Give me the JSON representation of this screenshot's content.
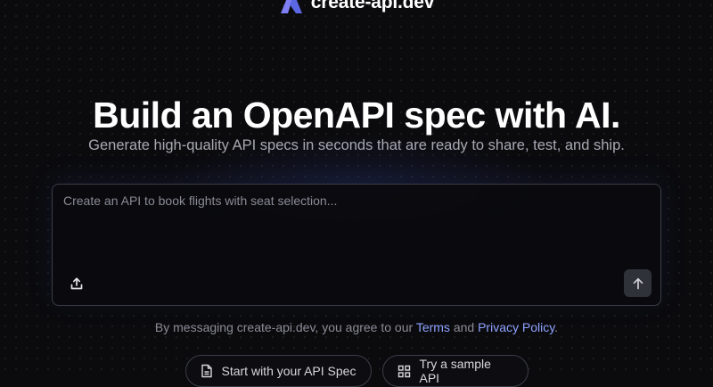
{
  "brand": {
    "name": "create-api.dev",
    "logo_icon": "logo-mark-icon",
    "colors": {
      "logo_left": "#7f7ff5",
      "logo_right": "#5b67e3"
    }
  },
  "hero": {
    "title": "Build an OpenAPI spec with AI.",
    "subtitle": "Generate high-quality API specs in seconds that are ready to share, test, and ship."
  },
  "prompt": {
    "value": "",
    "placeholder": "Create an API to book flights with seat selection...",
    "upload_icon": "upload-icon",
    "send_icon": "arrow-up-icon"
  },
  "disclaimer": {
    "prefix": "By messaging create-api.dev, you agree to our",
    "terms": "Terms",
    "and": "and",
    "privacy": "Privacy Policy",
    "suffix": "."
  },
  "actions": {
    "start_spec": {
      "label": "Start with your API Spec",
      "icon": "document-icon"
    },
    "sample_api": {
      "label": "Try a sample API",
      "icon": "grid-icon"
    }
  },
  "colors": {
    "background": "#0b0b0e",
    "link": "#8ea2ff",
    "border": "#3b3e48"
  }
}
